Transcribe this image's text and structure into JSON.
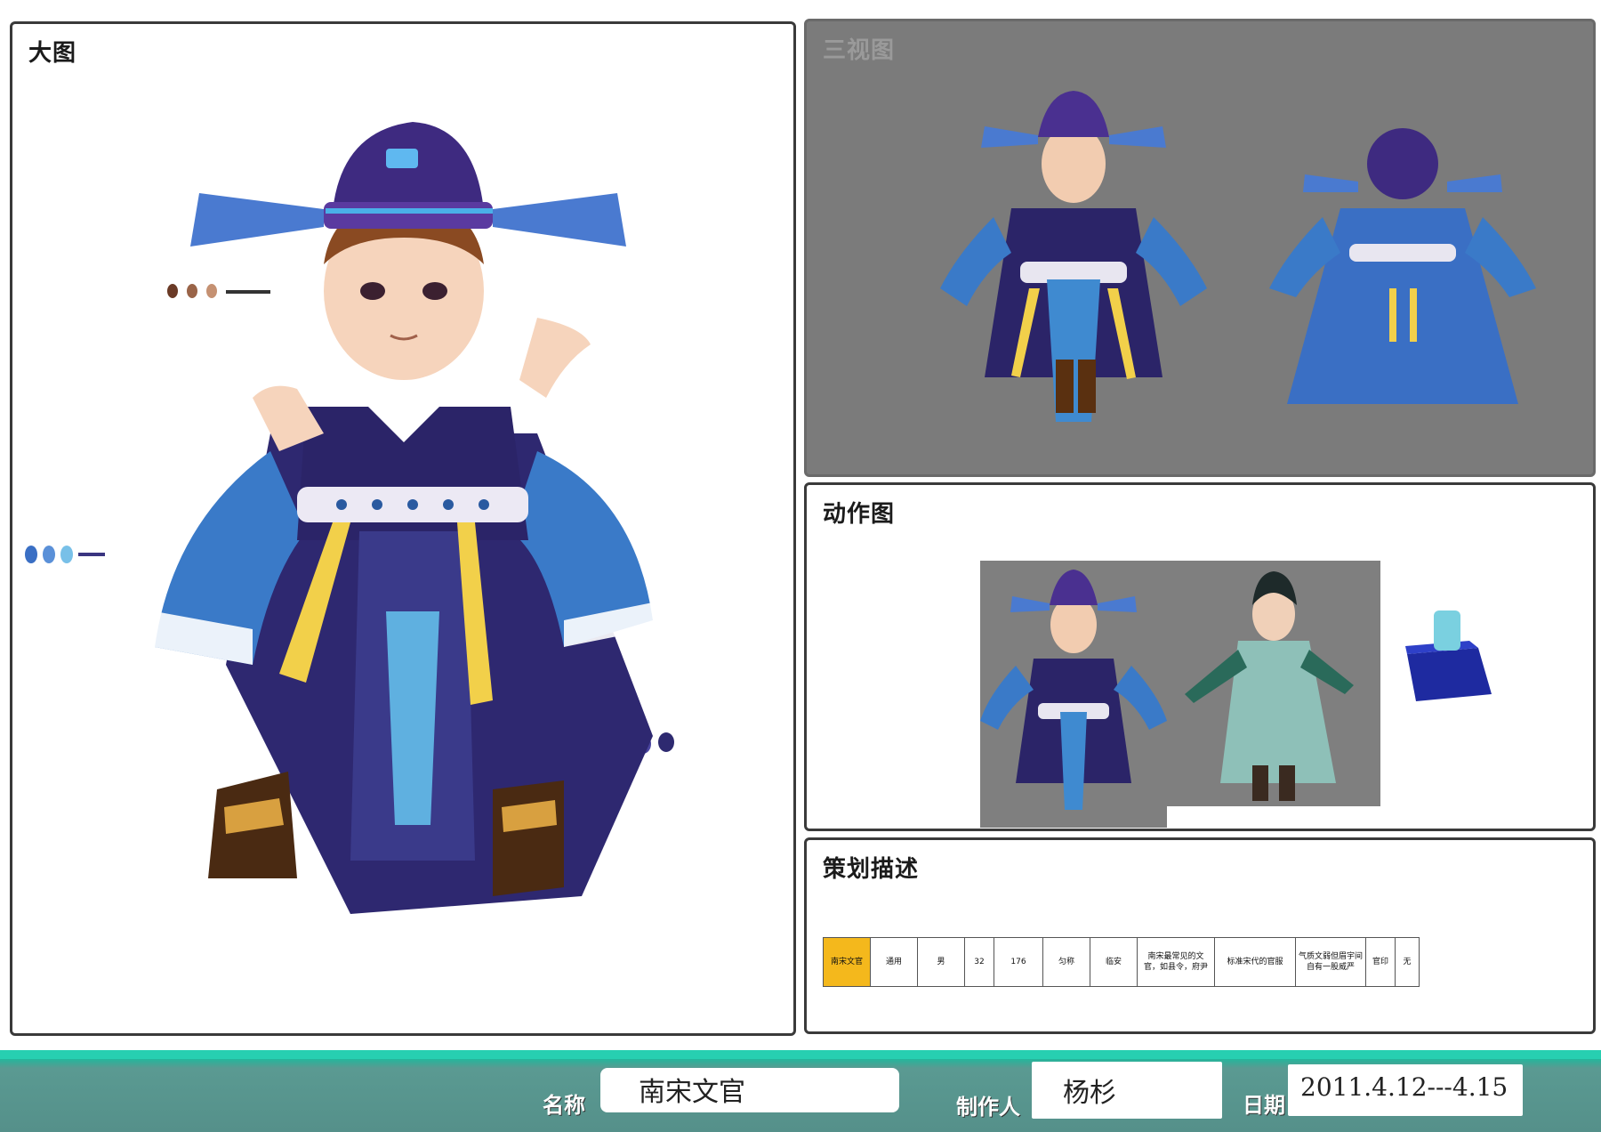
{
  "panels": {
    "main_title": "大图",
    "three_view_title": "三视图",
    "action_title": "动作图",
    "plan_title": "策划描述"
  },
  "table": {
    "cells": [
      "南宋文官",
      "通用",
      "男",
      "32",
      "176",
      "匀称",
      "临安",
      "南宋最常见的文官，如县令，府尹",
      "标准宋代的官服",
      "气质文弱但眉宇间自有一股威严",
      "官印",
      "无"
    ]
  },
  "footer": {
    "name_label": "名称",
    "name_value": "南宋文官",
    "author_label": "制作人",
    "author_value": "杨杉",
    "date_label": "日期",
    "date_value": "2011.4.12---4.15"
  },
  "colors": {
    "footer_teal": "#27cfb1",
    "highlight_cell": "#f4b81c",
    "robe_blue": "#3a6fc4",
    "robe_purple": "#3a2f7a"
  }
}
